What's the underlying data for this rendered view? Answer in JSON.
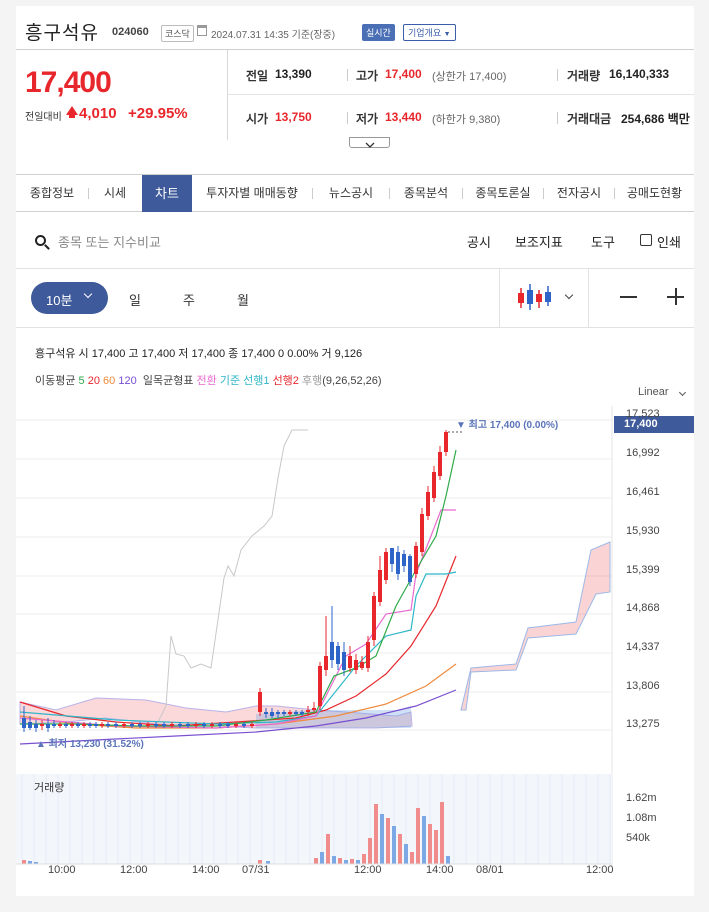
{
  "header": {
    "stock_name": "흥구석유",
    "stock_code": "024060",
    "market": "코스닥",
    "datetime": "2024.07.31 14:35 기준(장중)",
    "realtime_badge": "실시간",
    "corp_info": "기업개요"
  },
  "price": {
    "current": "17,400",
    "compare_label": "전일대비",
    "change": "4,010",
    "change_pct": "+29.95%",
    "prev_close_label": "전일",
    "prev_close": "13,390",
    "high_label": "고가",
    "high": "17,400",
    "upper_limit": "(상한가 17,400)",
    "volume_label": "거래량",
    "volume": "16,140,333",
    "open_label": "시가",
    "open": "13,750",
    "low_label": "저가",
    "low": "13,440",
    "lower_limit": "(하한가 9,380)",
    "amount_label": "거래대금",
    "amount": "254,686 백만"
  },
  "tabs": [
    "종합정보",
    "시세",
    "차트",
    "투자자별 매매동향",
    "뉴스공시",
    "종목분석",
    "종목토론실",
    "전자공시",
    "공매도현황"
  ],
  "active_tab": 2,
  "toolbar": {
    "search_placeholder": "종목 또는 지수비교",
    "disclosure": "공시",
    "indicators": "보조지표",
    "tools": "도구",
    "print": "인쇄"
  },
  "intervals": {
    "selected": "10분",
    "day": "일",
    "week": "주",
    "month": "월"
  },
  "legend": {
    "ohlc": "흥구석유 시 17,400 고 17,400 저 17,400 종 17,400 0 0.00% 거 9,126",
    "ma_title": "이동평균",
    "ma": [
      {
        "label": "5",
        "color": "#2eaa4a"
      },
      {
        "label": "20",
        "color": "#e8272c"
      },
      {
        "label": "60",
        "color": "#f08a3c"
      },
      {
        "label": "120",
        "color": "#7a4fd0"
      }
    ],
    "ichimoku_title": "일목균형표",
    "ichimoku": [
      {
        "label": "전환",
        "color": "#e96bd0"
      },
      {
        "label": "기준",
        "color": "#2fb6c8"
      },
      {
        "label": "선행1",
        "color": "#2fb6c8"
      },
      {
        "label": "선행2",
        "color": "#e8272c"
      },
      {
        "label": "후행",
        "color": "#999999"
      }
    ],
    "ichimoku_params": "(9,26,52,26)"
  },
  "scale_mode": "Linear",
  "chart_data": {
    "type": "candlestick",
    "current_price_tag": "17,400",
    "max_marker": "▼ 최고 17,400 (0.00%)",
    "min_marker": "▲ 최저 13,230 (31.52%)",
    "yticks": [
      "17,523",
      "16,992",
      "16,461",
      "15,930",
      "15,399",
      "14,868",
      "14,337",
      "13,806",
      "13,275"
    ],
    "xticks": [
      "10:00",
      "12:00",
      "14:00",
      "07/31",
      "12:00",
      "14:00",
      "08/01",
      "12:00"
    ],
    "volume_label": "거래량",
    "volume_yticks": [
      "1.62m",
      "1.08m",
      "540k"
    ],
    "colors": {
      "up": "#e8272c",
      "down": "#2e63c8",
      "vol_up": "#f08c8c",
      "vol_down": "#7da8e6"
    }
  }
}
